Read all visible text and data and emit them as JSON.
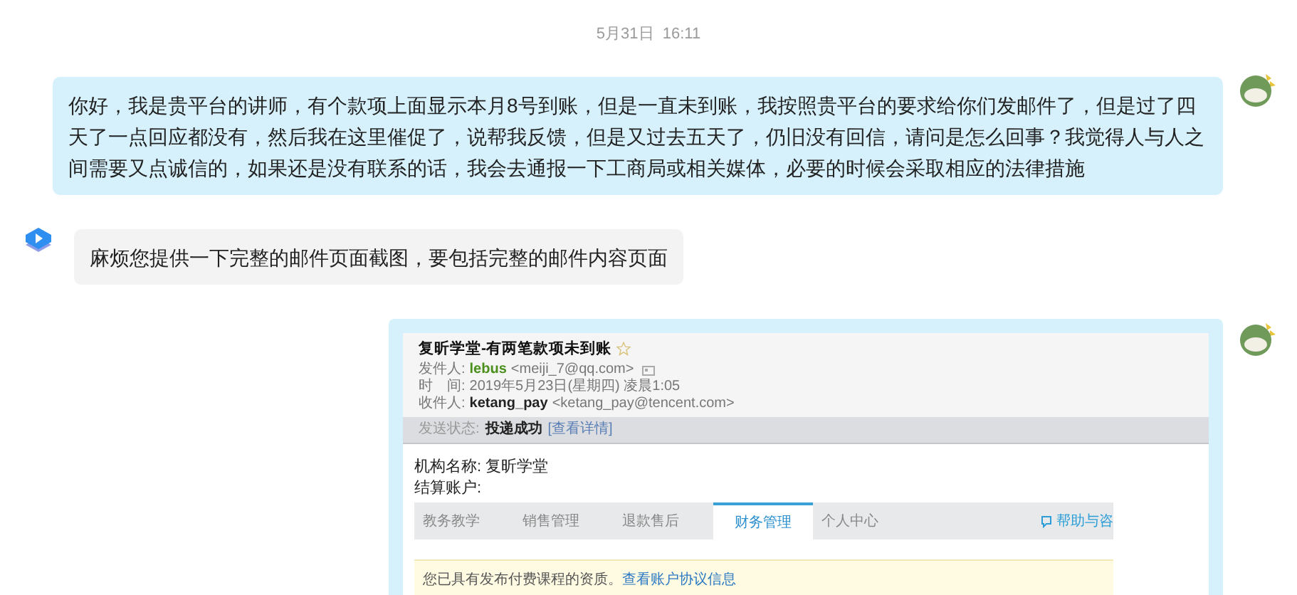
{
  "timestamp": "5月31日  16:11",
  "messages": [
    {
      "kind": "text",
      "outgoing": true,
      "text": "你好，我是贵平台的讲师，有个款项上面显示本月8号到账，但是一直未到账，我按照贵平台的要求给你们发邮件了，但是过了四天了一点回应都没有，然后我在这里催促了，说帮我反馈，但是又过去五天了，仍旧没有回信，请问是怎么回事？我觉得人与人之间需要又点诚信的，如果还是没有联系的话，我会去通报一下工商局或相关媒体，必要的时候会采取相应的法律措施"
    },
    {
      "kind": "text",
      "outgoing": false,
      "text": "麻烦您提供一下完整的邮件页面截图，要包括完整的邮件内容页面"
    },
    {
      "kind": "email_screenshot",
      "outgoing": true,
      "email": {
        "subject": "复昕学堂-有两笔款项未到账",
        "starred": false,
        "fields": [
          {
            "kind": "sender",
            "label": "发件人:",
            "name": "lebus",
            "address": "<meiji_7@qq.com>"
          },
          {
            "kind": "time",
            "label": "时　间:",
            "value": "2019年5月23日(星期四) 凌晨1:05"
          },
          {
            "kind": "recipient",
            "label": "收件人:",
            "name": "ketang_pay",
            "address": "<ketang_pay@tencent.com>"
          }
        ],
        "status": {
          "label": "发送状态:",
          "value": "投递成功",
          "link": "[查看详情]"
        },
        "org": {
          "label": "机构名称:",
          "value": "复昕学堂"
        },
        "account": {
          "label": "结算账户:"
        },
        "tabs": [
          {
            "label": "教务教学",
            "selected": false
          },
          {
            "label": "销售管理",
            "selected": false
          },
          {
            "label": "退款售后",
            "selected": false
          },
          {
            "label": "财务管理",
            "selected": true
          },
          {
            "label": "个人中心",
            "selected": false
          }
        ],
        "help_link": "帮助与咨",
        "notice": {
          "text": "您已具有发布付费课程的资质。",
          "link": "查看账户协议信息"
        }
      }
    }
  ]
}
